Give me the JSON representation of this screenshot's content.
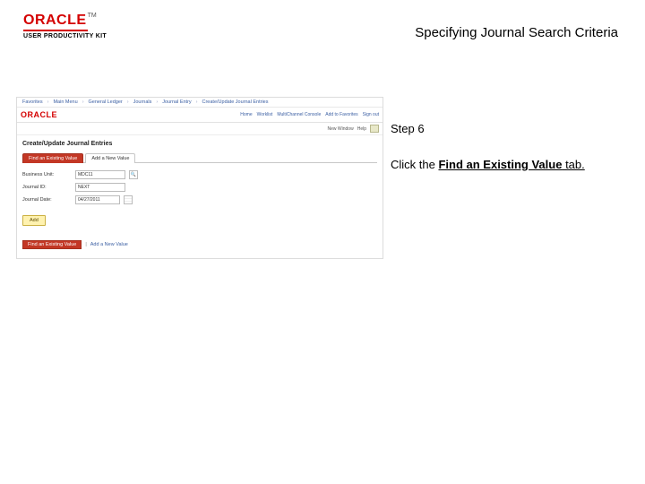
{
  "header": {
    "brand": "ORACLE",
    "brand_sub": "USER PRODUCTIVITY KIT",
    "page_title": "Specifying Journal Search Criteria"
  },
  "instruction": {
    "step_label": "Step 6",
    "text_pre": "Click the ",
    "tab_name": "Find an Existing Value",
    "text_post": " tab."
  },
  "shot": {
    "topnav": {
      "items": [
        "Favorites",
        "Main Menu",
        "General Ledger",
        "Journals",
        "Journal Entry",
        "Create/Update Journal Entries"
      ]
    },
    "oracle": "ORACLE",
    "toplinks": [
      "Home",
      "Worklist",
      "MultiChannel Console",
      "Add to Favorites",
      "Sign out"
    ],
    "greybar": {
      "label": "New Window",
      "help": "Help"
    },
    "heading": "Create/Update Journal Entries",
    "tabs": {
      "find": "Find an Existing Value",
      "add": "Add a New Value"
    },
    "form": {
      "bu_label": "Business Unit:",
      "bu_value": "MDC11",
      "jid_label": "Journal ID:",
      "jid_value": "NEXT",
      "jd_label": "Journal Date:",
      "jd_value": "04/27/2011"
    },
    "add_button": "Add",
    "bottom": {
      "find": "Find an Existing Value",
      "add": "Add a New Value"
    }
  }
}
